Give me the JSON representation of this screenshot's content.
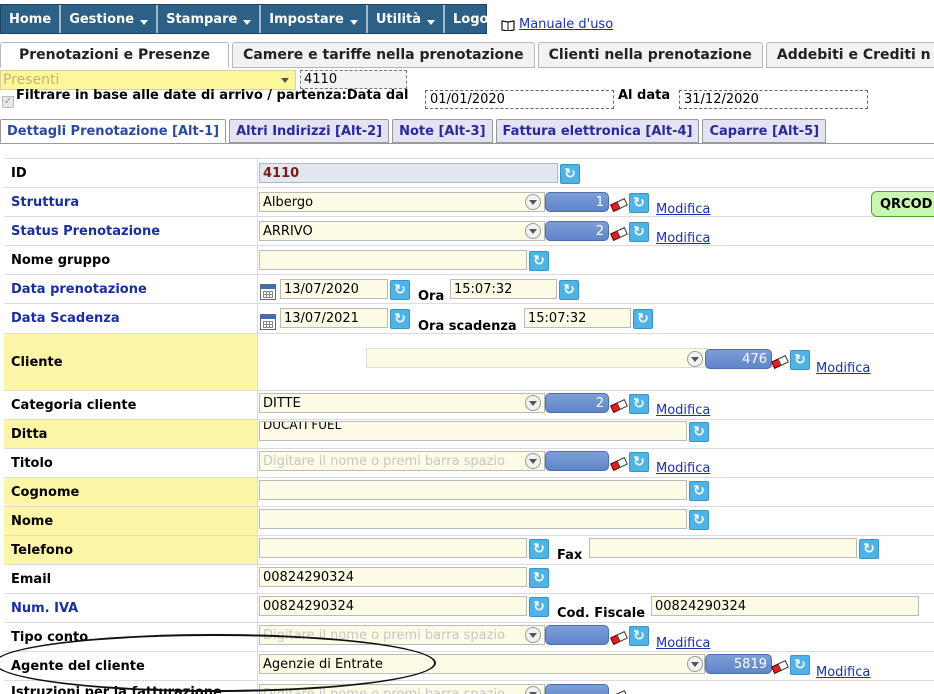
{
  "menu": {
    "items": [
      {
        "label": "Home",
        "caret": false
      },
      {
        "label": "Gestione",
        "caret": true
      },
      {
        "label": "Stampare",
        "caret": true
      },
      {
        "label": "Impostare",
        "caret": true
      },
      {
        "label": "Utilità",
        "caret": true
      },
      {
        "label": "Logout",
        "caret": false
      }
    ],
    "manual_link": "Manuale d'uso"
  },
  "main_tabs": [
    "Prenotazioni e Presenze",
    "Camere e tariffe nella prenotazione",
    "Clienti nella prenotazione",
    "Addebiti e Crediti n"
  ],
  "filter": {
    "status_select": "Presenti",
    "booking_number": "4110",
    "checkbox_label": "Filtrare in base alle date di arrivo / partenza:Data dal",
    "date_from": "01/01/2020",
    "date_to_label": "Al data",
    "date_to": "31/12/2020"
  },
  "sub_tabs": [
    "Dettagli Prenotazione [Alt-1]",
    "Altri Indirizzi [Alt-2]",
    "Note [Alt-3]",
    "Fattura elettronica [Alt-4]",
    "Caparre [Alt-5]"
  ],
  "form": {
    "modify_label": "Modifica",
    "placeholder": "Digitare il nome o premi barra spazio",
    "id": {
      "label": "ID",
      "value": "4110"
    },
    "struttura": {
      "label": "Struttura",
      "value": "Albergo",
      "code": "1"
    },
    "status": {
      "label": "Status Prenotazione",
      "value": "ARRIVO",
      "code": "2"
    },
    "nome_gruppo": {
      "label": "Nome gruppo",
      "value": ""
    },
    "data_prenotazione": {
      "label": "Data prenotazione",
      "date": "13/07/2020",
      "time_label": "Ora",
      "time": "15:07:32"
    },
    "data_scadenza": {
      "label": "Data Scadenza",
      "date": "13/07/2021",
      "time_label": "Ora scadenza",
      "time": "15:07:32"
    },
    "cliente": {
      "label": "Cliente",
      "value": "",
      "code": "476",
      "qr_label": "QRCOD"
    },
    "categoria": {
      "label": "Categoria cliente",
      "value": "DITTE",
      "code": "2"
    },
    "ditta": {
      "label": "Ditta",
      "value": "DUCATI FUEL"
    },
    "titolo": {
      "label": "Titolo",
      "code": ""
    },
    "cognome": {
      "label": "Cognome",
      "value": ""
    },
    "nome": {
      "label": "Nome",
      "value": ""
    },
    "telefono": {
      "label": "Telefono",
      "value": "",
      "fax_label": "Fax",
      "fax": ""
    },
    "email": {
      "label": "Email",
      "value": "00824290324"
    },
    "num_iva": {
      "label": "Num. IVA",
      "value": "00824290324",
      "cf_label": "Cod. Fiscale",
      "cf": "00824290324"
    },
    "tipo_conto": {
      "label": "Tipo conto",
      "code": ""
    },
    "agente": {
      "label": "Agente del cliente",
      "value": "Agenzie di Entrate",
      "code": "5819"
    },
    "istruzioni": {
      "label": "Istruzioni per la fatturazione"
    }
  },
  "colors": {
    "menu_bg": "#2d6087",
    "highlight_row": "#fdf6a6",
    "label_blue": "#1a2ea0",
    "refresh_btn": "#4fb3e8",
    "id_badge": "#6b8fcf"
  }
}
